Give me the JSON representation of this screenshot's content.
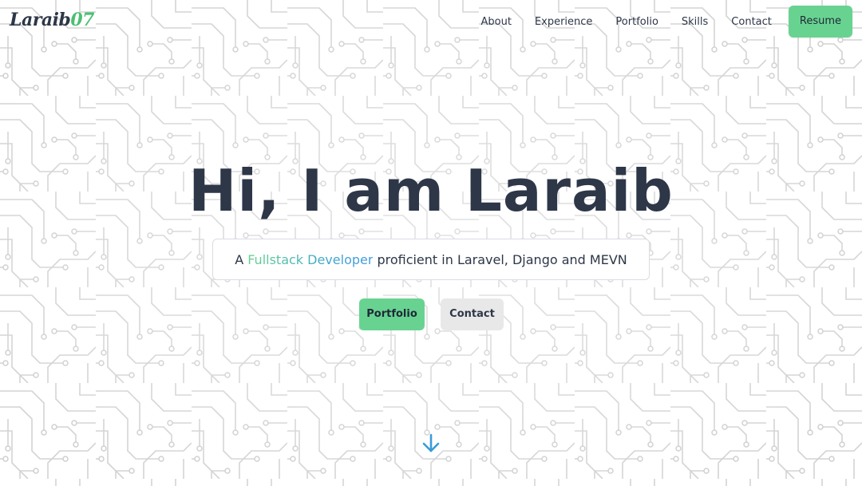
{
  "logo": {
    "text": "Laraib",
    "accent": "07"
  },
  "nav": {
    "items": [
      {
        "label": "About"
      },
      {
        "label": "Experience"
      },
      {
        "label": "Portfolio"
      },
      {
        "label": "Skills"
      },
      {
        "label": "Contact"
      }
    ],
    "resume_label": "Resume"
  },
  "hero": {
    "title": "Hi, I am Laraib",
    "subtitle_prefix": "A",
    "subtitle_highlight": "Fullstack Developer",
    "subtitle_suffix": "proficient in Laravel, Django and MEVN",
    "portfolio_button": "Portfolio",
    "contact_button": "Contact",
    "scroll_icon": "arrow-down-icon"
  },
  "colors": {
    "accent_green": "#68d391",
    "accent_blue": "#4299e1",
    "text_dark": "#2d3748",
    "circuit_line": "#d6d6d6"
  }
}
